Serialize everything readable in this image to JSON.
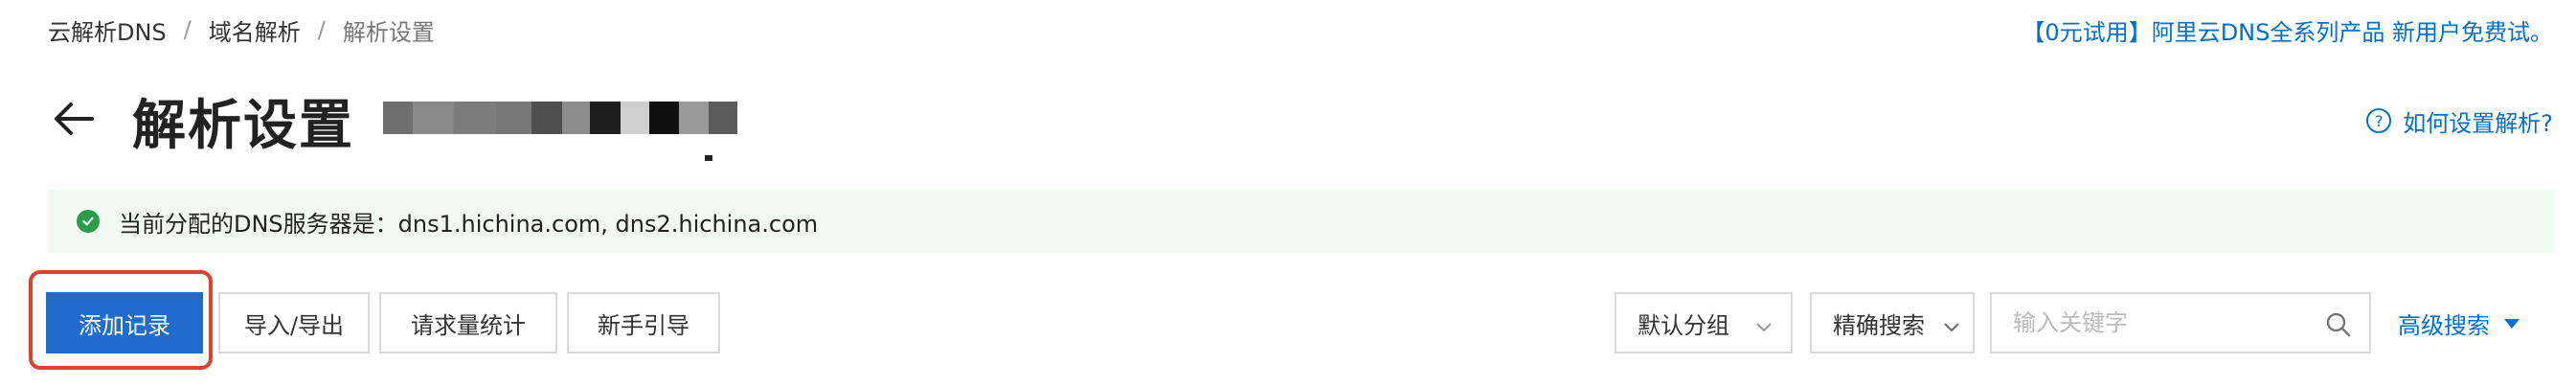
{
  "breadcrumb": {
    "items": [
      "云解析DNS",
      "域名解析",
      "解析设置"
    ],
    "separator": "/"
  },
  "promo": {
    "text": "【0元试用】阿里云DNS全系列产品 新用户免费试。"
  },
  "header": {
    "title": "解析设置",
    "help_label": "如何设置解析?",
    "help_icon_glyph": "?"
  },
  "notice": {
    "text": "当前分配的DNS服务器是：dns1.hichina.com, dns2.hichina.com"
  },
  "toolbar": {
    "add_record_label": "添加记录",
    "import_export_label": "导入/导出",
    "request_stats_label": "请求量统计",
    "guide_label": "新手引导",
    "group_select_value": "默认分组",
    "search_mode_value": "精确搜索",
    "search_placeholder": "输入关键字",
    "advanced_search_label": "高级搜索"
  },
  "colors": {
    "accent": "#0070cc",
    "primary_button": "#1f6ccc",
    "highlight": "#e0412e",
    "success": "#2a9c4a",
    "notice_bg": "#f0faf2"
  },
  "icons": [
    "back-arrow-icon",
    "help-circle-icon",
    "check-circle-icon",
    "chevron-down-icon",
    "search-icon",
    "caret-down-icon"
  ]
}
